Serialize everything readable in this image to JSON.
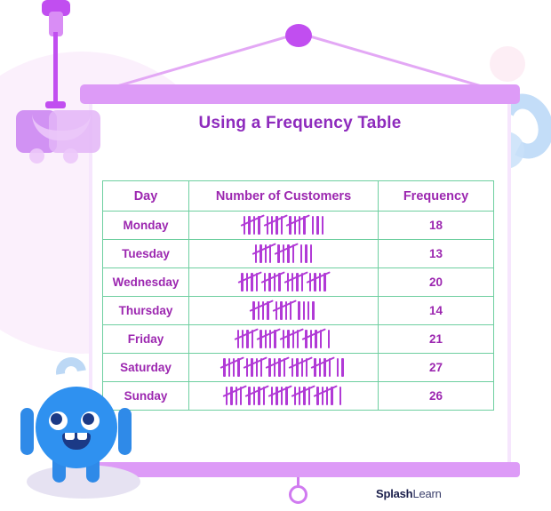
{
  "banner": {
    "title": "Using a Frequency Table",
    "hanger_icon": "clamp-hanger-icon",
    "knob_icon": "cord-knob-icon",
    "pull_ring_icon": "pull-ring-icon"
  },
  "colors": {
    "title_purple": "#8e2bbd",
    "text_purple": "#9c27b0",
    "tally_purple": "#b13ad6",
    "border_green": "#6ecfa0",
    "banner_bar": "#dd9bf7",
    "mascot_blue": "#2f91f0",
    "accent_magenta": "#c14ef0"
  },
  "table": {
    "headers": [
      "Day",
      "Number of Customers",
      "Frequency"
    ],
    "rows": [
      {
        "day": "Monday",
        "groups": 3,
        "singles": 3,
        "frequency": "18"
      },
      {
        "day": "Tuesday",
        "groups": 2,
        "singles": 3,
        "frequency": "13"
      },
      {
        "day": "Wednesday",
        "groups": 4,
        "singles": 0,
        "frequency": "20"
      },
      {
        "day": "Thursday",
        "groups": 2,
        "singles": 4,
        "frequency": "14"
      },
      {
        "day": "Friday",
        "groups": 4,
        "singles": 1,
        "frequency": "21"
      },
      {
        "day": "Saturday",
        "groups": 5,
        "singles": 2,
        "frequency": "27"
      },
      {
        "day": "Sunday",
        "groups": 5,
        "singles": 1,
        "frequency": "26"
      }
    ]
  },
  "mascot": {
    "name": "blue-mascot-character"
  },
  "watermark": {
    "bold": "Splash",
    "light": "Learn"
  },
  "chart_data": {
    "type": "table",
    "title": "Using a Frequency Table",
    "columns": [
      "Day",
      "Number of Customers",
      "Frequency"
    ],
    "categories": [
      "Monday",
      "Tuesday",
      "Wednesday",
      "Thursday",
      "Friday",
      "Saturday",
      "Sunday"
    ],
    "values": [
      18,
      13,
      20,
      14,
      21,
      27,
      26
    ],
    "tally_representation": [
      "5+5+5+3",
      "5+5+3",
      "5+5+5+5",
      "5+5+4",
      "5+5+5+5+1",
      "5+5+5+5+5+2",
      "5+5+5+5+5+1"
    ],
    "xlabel": "Day",
    "ylabel": "Frequency"
  }
}
